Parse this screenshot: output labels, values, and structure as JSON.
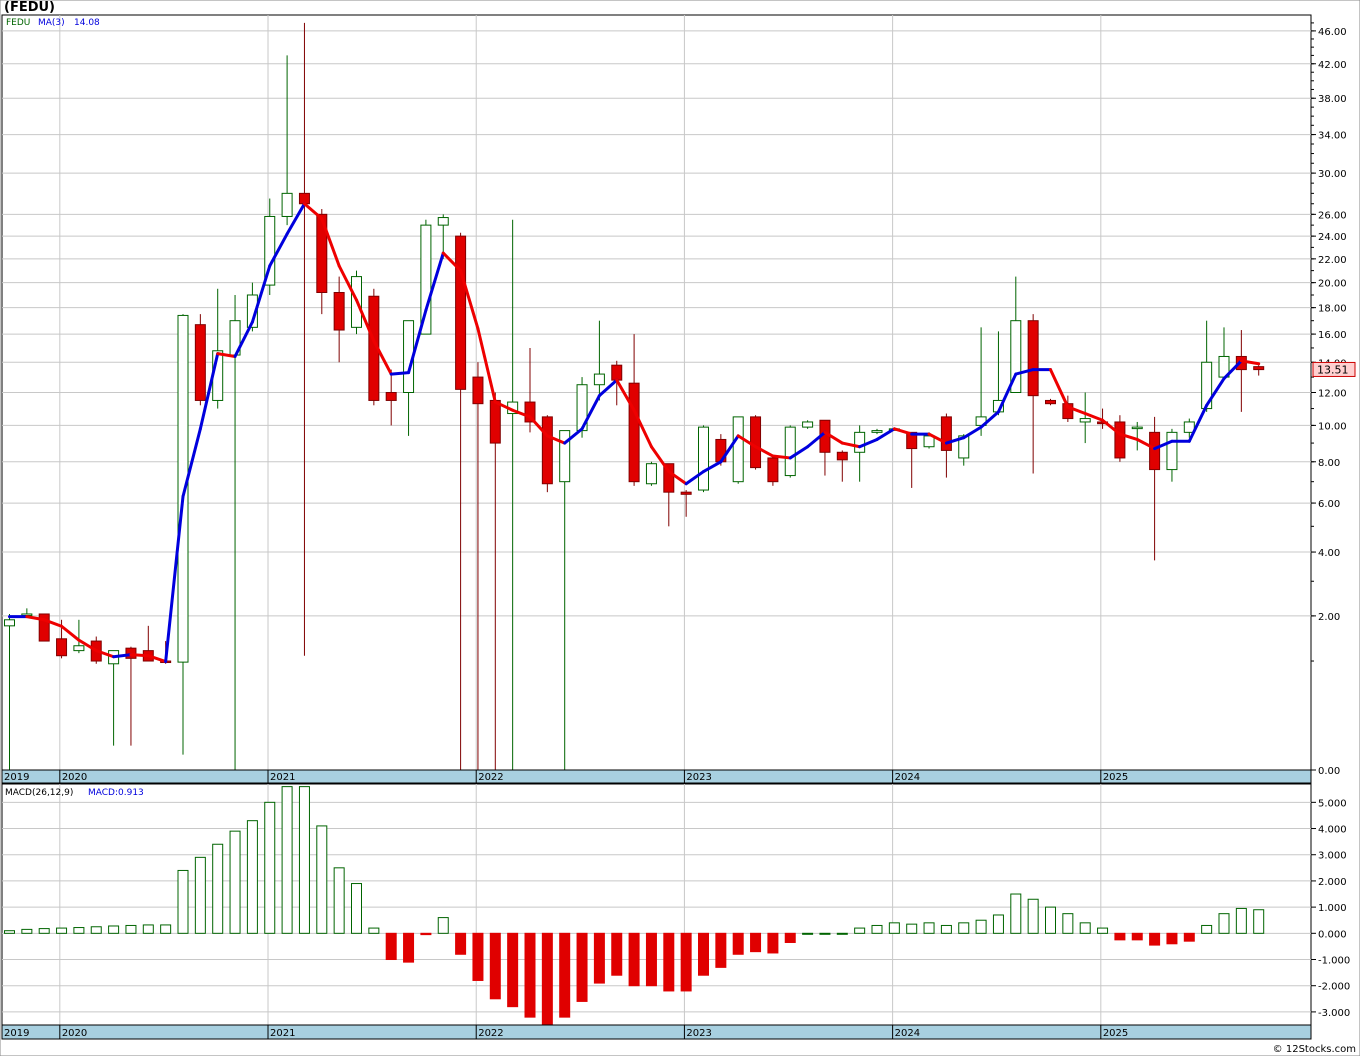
{
  "title": "(FEDU)",
  "credit": "© 12Stocks.com",
  "colors": {
    "up": "#006400",
    "down": "#e00000",
    "ma_up": "#0000dd",
    "ma_down": "#ee0000",
    "band": "#a8d0e0",
    "grid": "#c8c8c8",
    "price_box": "#ffd0d0"
  },
  "price_panel": {
    "symbol": "FEDU",
    "ma_label": "MA(3)",
    "ma_value": "14.08",
    "last_price": "13.51",
    "y_ticks": [
      "46.00",
      "42.00",
      "38.00",
      "34.00",
      "30.00",
      "26.00",
      "24.00",
      "22.00",
      "20.00",
      "18.00",
      "16.00",
      "14.00",
      "12.00",
      "10.00",
      "8.00",
      "6.00",
      "4.00",
      "2.00",
      "0.00"
    ]
  },
  "macd_panel": {
    "label": "MACD(26,12,9)",
    "value_label": "MACD:0.913",
    "y_ticks": [
      "5.000",
      "4.000",
      "3.000",
      "2.000",
      "1.000",
      "0.000",
      "-1.000",
      "-2.000",
      "-3.000"
    ]
  },
  "x_labels": [
    "2019",
    "2020",
    "2021",
    "2022",
    "2023",
    "2024",
    "2025"
  ],
  "chart_data": [
    {
      "type": "candlestick",
      "title": "(FEDU)",
      "scale": "sqrt",
      "ylim": [
        0,
        48
      ],
      "candles": [
        [
          1.75,
          2.05,
          0,
          1.9
        ],
        [
          2.05,
          2.2,
          2.0,
          2.05
        ],
        [
          2.05,
          2.05,
          1.4,
          1.4
        ],
        [
          1.45,
          1.9,
          1.05,
          1.1
        ],
        [
          1.2,
          1.9,
          1.15,
          1.3
        ],
        [
          1.4,
          1.5,
          0.95,
          1.0
        ],
        [
          0.95,
          1.1,
          0.05,
          1.2
        ],
        [
          1.25,
          1.28,
          0.05,
          1.05
        ],
        [
          1.2,
          1.75,
          1.0,
          1.0
        ],
        [
          1.0,
          1.4,
          0.95,
          0.98
        ],
        [
          0.98,
          17.5,
          0.02,
          17.4
        ],
        [
          16.7,
          17.5,
          11.2,
          11.5
        ],
        [
          11.5,
          19.5,
          11.0,
          14.8
        ],
        [
          14.5,
          19.0,
          0.0,
          17.0
        ],
        [
          16.5,
          20.0,
          16.2,
          19.0
        ],
        [
          19.8,
          27.5,
          19.0,
          25.8
        ],
        [
          25.8,
          43.0,
          25.0,
          28.0
        ],
        [
          28.0,
          47.0,
          1.1,
          27.0
        ],
        [
          26.0,
          26.5,
          17.5,
          19.2
        ],
        [
          19.2,
          20.5,
          14.0,
          16.3
        ],
        [
          16.5,
          21.0,
          16.0,
          20.5
        ],
        [
          18.9,
          19.5,
          11.2,
          11.5
        ],
        [
          12.0,
          13.5,
          10.0,
          11.5
        ],
        [
          12.0,
          17.0,
          9.4,
          17.0
        ],
        [
          16.0,
          25.5,
          16.0,
          25.0
        ],
        [
          25.0,
          26.0,
          22.0,
          25.7
        ],
        [
          24.0,
          24.3,
          0,
          12.2
        ],
        [
          13.0,
          14.0,
          0,
          11.3
        ],
        [
          11.5,
          12.0,
          0,
          9.0
        ],
        [
          10.7,
          25.5,
          0,
          11.4
        ],
        [
          11.4,
          15.0,
          9.6,
          10.2
        ],
        [
          10.5,
          10.6,
          6.5,
          6.9
        ],
        [
          7.0,
          9.7,
          0,
          9.7
        ],
        [
          9.7,
          13.0,
          9.3,
          12.5
        ],
        [
          12.5,
          17.0,
          11.5,
          13.2
        ],
        [
          13.8,
          14.1,
          11.2,
          12.8
        ],
        [
          12.6,
          16.0,
          6.8,
          7.0
        ],
        [
          6.9,
          8.0,
          6.8,
          7.9
        ],
        [
          7.9,
          7.9,
          5.0,
          6.5
        ],
        [
          6.5,
          6.6,
          5.4,
          6.4
        ],
        [
          6.6,
          10.0,
          6.5,
          9.9
        ],
        [
          9.2,
          9.5,
          7.8,
          8.0
        ],
        [
          7.0,
          10.5,
          6.9,
          10.5
        ],
        [
          10.5,
          10.6,
          7.6,
          7.7
        ],
        [
          8.2,
          8.3,
          6.8,
          7.0
        ],
        [
          7.3,
          10.0,
          7.2,
          9.9
        ],
        [
          9.9,
          10.3,
          9.8,
          10.2
        ],
        [
          10.3,
          10.3,
          7.3,
          8.5
        ],
        [
          8.5,
          8.6,
          7.0,
          8.1
        ],
        [
          8.5,
          10.0,
          7.0,
          9.6
        ],
        [
          9.6,
          9.8,
          9.5,
          9.7
        ],
        [
          9.8,
          9.8,
          9.7,
          9.8
        ],
        [
          9.6,
          9.6,
          6.7,
          8.7
        ],
        [
          8.8,
          9.6,
          8.7,
          9.4
        ],
        [
          10.5,
          10.7,
          7.2,
          8.6
        ],
        [
          8.2,
          9.5,
          7.8,
          9.4
        ],
        [
          10.0,
          16.5,
          9.4,
          10.5
        ],
        [
          10.8,
          16.2,
          10.6,
          11.5
        ],
        [
          12.0,
          20.5,
          12.0,
          17.0
        ],
        [
          17.0,
          17.5,
          7.4,
          11.8
        ],
        [
          11.5,
          11.6,
          11.2,
          11.3
        ],
        [
          11.3,
          11.8,
          10.2,
          10.4
        ],
        [
          10.2,
          12.0,
          9.0,
          10.4
        ],
        [
          10.2,
          11.0,
          9.8,
          10.1
        ],
        [
          10.2,
          10.6,
          8.0,
          8.2
        ],
        [
          9.9,
          10.2,
          8.6,
          9.9
        ],
        [
          9.6,
          10.5,
          3.7,
          7.6
        ],
        [
          7.6,
          9.8,
          7.0,
          9.6
        ],
        [
          9.6,
          10.4,
          9.3,
          10.2
        ],
        [
          11.0,
          17.0,
          10.8,
          14.0
        ],
        [
          13.0,
          16.5,
          13.0,
          14.4
        ],
        [
          14.4,
          16.3,
          10.8,
          13.5
        ],
        [
          13.7,
          13.8,
          13.1,
          13.5
        ]
      ],
      "ma": [
        1.98,
        1.98,
        1.9,
        1.74,
        1.42,
        1.2,
        1.08,
        1.12,
        1.1,
        0.99,
        6.3,
        9.8,
        14.6,
        14.4,
        16.9,
        21.4,
        24.2,
        27.0,
        25.6,
        21.4,
        18.6,
        15.5,
        13.2,
        13.3,
        17.8,
        22.5,
        21.0,
        16.4,
        11.4,
        10.9,
        10.5,
        9.4,
        9.0,
        9.8,
        11.8,
        12.8,
        10.9,
        8.8,
        7.5,
        6.9,
        7.5,
        8.0,
        9.4,
        8.8,
        8.3,
        8.2,
        8.8,
        9.6,
        9.0,
        8.8,
        9.2,
        9.8,
        9.5,
        9.5,
        9.0,
        9.3,
        9.9,
        10.8,
        13.2,
        13.5,
        13.5,
        11.1,
        10.7,
        10.3,
        9.5,
        9.2,
        8.7,
        9.1,
        9.1,
        11.2,
        12.9,
        14.1,
        13.9
      ],
      "macd": [
        0.1,
        0.15,
        0.18,
        0.2,
        0.22,
        0.25,
        0.28,
        0.3,
        0.32,
        0.32,
        2.4,
        2.9,
        3.4,
        3.9,
        4.3,
        5.0,
        5.6,
        5.6,
        4.1,
        2.5,
        1.9,
        0.2,
        -1.0,
        -1.1,
        -0.05,
        0.6,
        -0.8,
        -1.8,
        -2.5,
        -2.8,
        -3.2,
        -3.5,
        -3.2,
        -2.6,
        -1.9,
        -1.6,
        -2.0,
        -2.0,
        -2.2,
        -2.2,
        -1.6,
        -1.3,
        -0.8,
        -0.7,
        -0.75,
        -0.35,
        0.0,
        0.0,
        0.0,
        0.2,
        0.3,
        0.4,
        0.35,
        0.4,
        0.3,
        0.4,
        0.5,
        0.7,
        1.5,
        1.3,
        1.0,
        0.75,
        0.4,
        0.2,
        -0.25,
        -0.25,
        -0.45,
        -0.4,
        -0.3,
        0.3,
        0.75,
        0.95,
        0.9
      ],
      "macd_ylim": [
        -3.5,
        5.7
      ],
      "year_boundaries": [
        {
          "label": "2019",
          "index": -0.5
        },
        {
          "label": "2020",
          "index": 2.9
        },
        {
          "label": "2021",
          "index": 14.9
        },
        {
          "label": "2022",
          "index": 26.9
        },
        {
          "label": "2023",
          "index": 38.9
        },
        {
          "label": "2024",
          "index": 50.9
        },
        {
          "label": "2025",
          "index": 62.9
        }
      ]
    }
  ]
}
